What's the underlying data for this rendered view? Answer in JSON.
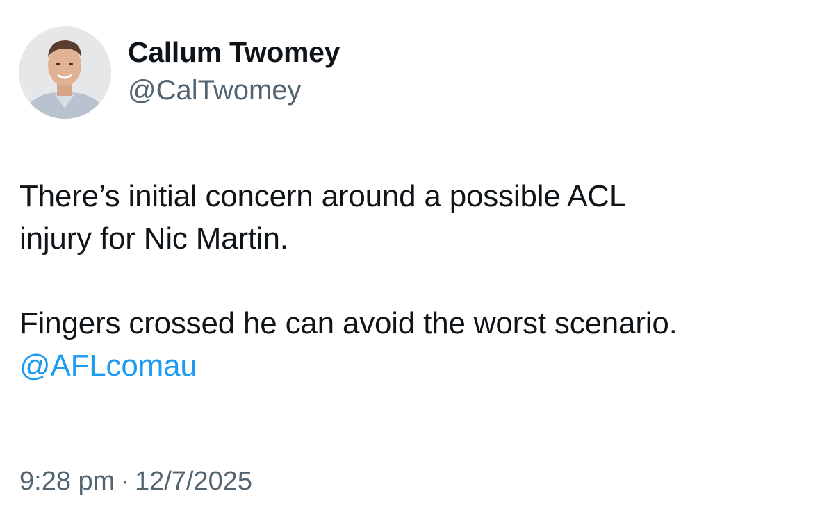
{
  "author": {
    "display_name": "Callum Twomey",
    "handle": "@CalTwomey"
  },
  "tweet": {
    "line1": "There’s initial concern around a possible ACL",
    "line2": "injury for Nic Martin.",
    "line3": "Fingers crossed he can avoid the worst scenario.",
    "mention": "@AFLcomau"
  },
  "meta": {
    "time": "9:28 pm",
    "separator": "·",
    "date": "12/7/2025"
  },
  "colors": {
    "text": "#0f1419",
    "secondary": "#536471",
    "link": "#1d9bf0"
  }
}
